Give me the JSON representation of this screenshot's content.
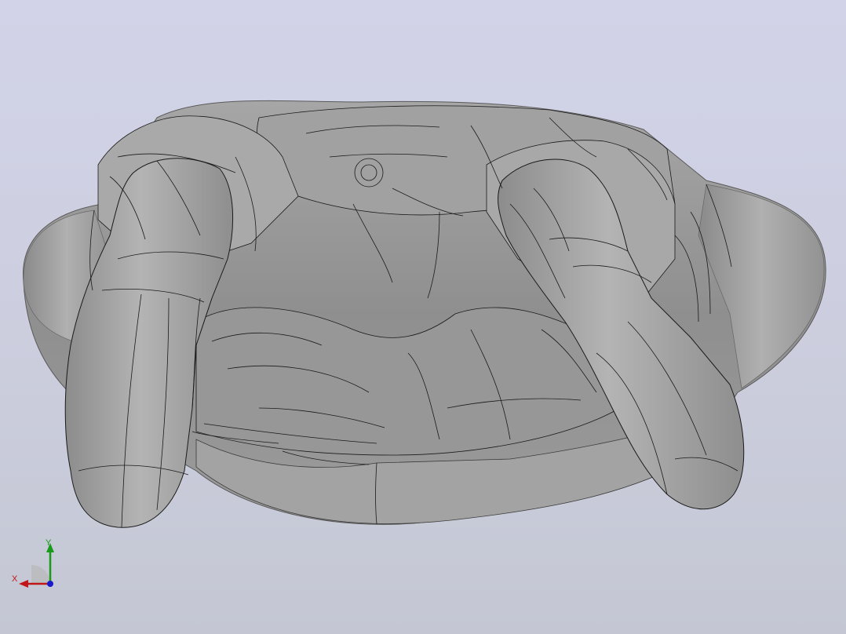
{
  "viewport": {
    "background_top": "#d2d3e8",
    "background_bottom": "#c4c7d3",
    "model_fill": "#9c9c9c",
    "model_edge_color": "#1a1a1a"
  },
  "triad": {
    "y_label": "Y",
    "x_label": "X",
    "y_color": "#1a9a1a",
    "x_color": "#c01818",
    "z_color": "#1a1acc"
  }
}
